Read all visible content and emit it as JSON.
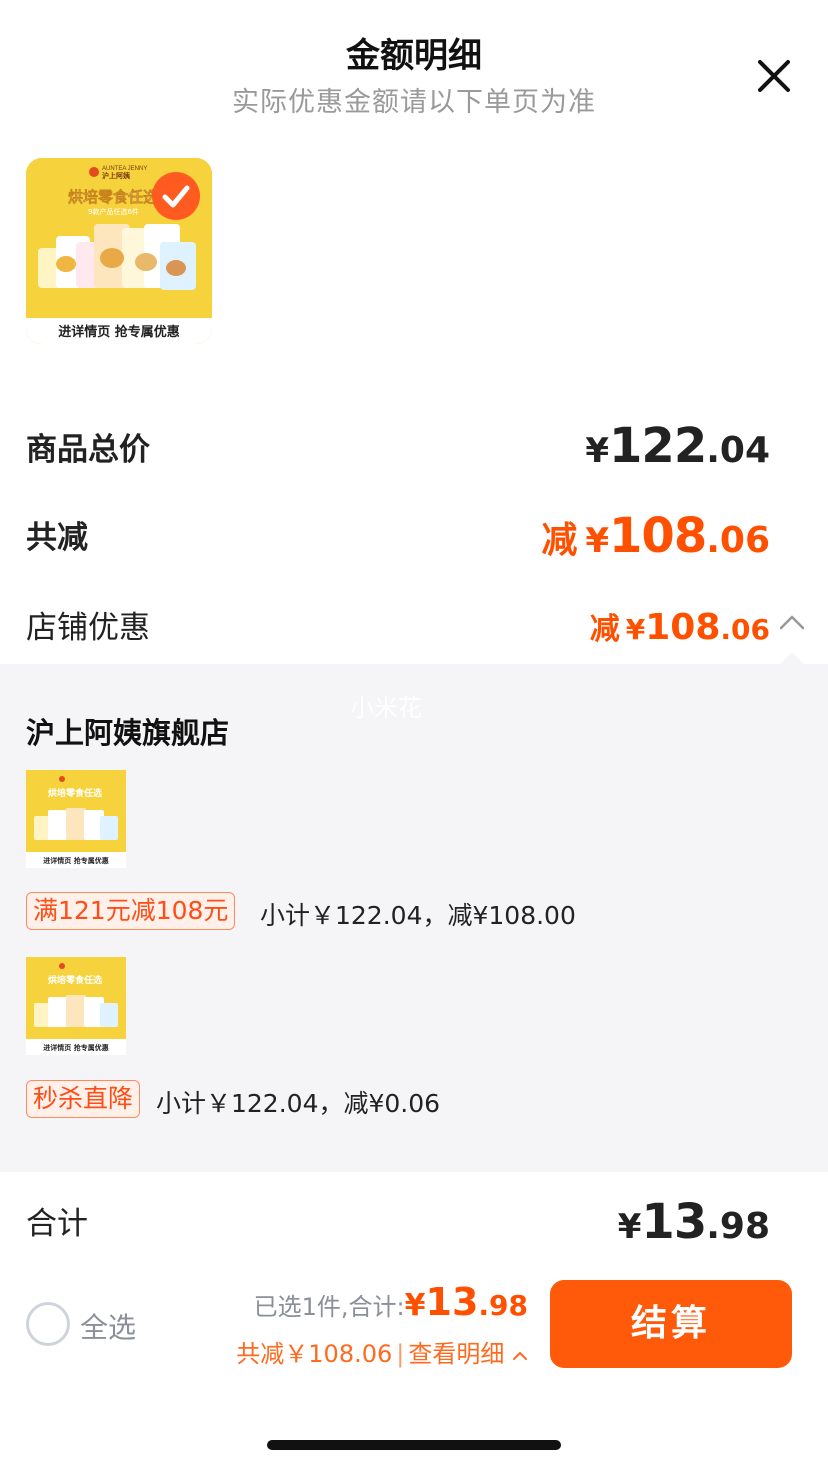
{
  "header": {
    "title": "金额明细",
    "subtitle": "实际优惠金额请以下单页为准",
    "close_icon": "close-icon"
  },
  "product": {
    "image_label": "进详情页 抢专属优惠",
    "image_heading": "烘培零食任选",
    "image_sub": "9款产品任选6件",
    "brand": "AUNTEA JENNY 沪上阿姨",
    "selected": true
  },
  "summary": {
    "goods_total_label": "商品总价",
    "goods_total": {
      "yen": "¥",
      "int": "122",
      "dec": ".04"
    },
    "total_discount_label": "共减",
    "total_discount": {
      "prefix": "减",
      "yen": "¥",
      "int": "108",
      "dec": ".06"
    },
    "store_discount_label": "店铺优惠",
    "store_discount": {
      "prefix": "减",
      "yen": "¥",
      "int": "108",
      "dec": ".06"
    }
  },
  "panel": {
    "watermark": "小米花",
    "store_name": "沪上阿姨旗舰店",
    "items": [
      {
        "tag": "满121元减108元",
        "text": "小计￥122.04，减¥108.00"
      },
      {
        "tag": "秒杀直降",
        "text": "小计￥122.04，减¥0.06"
      }
    ]
  },
  "total": {
    "label": "合计",
    "value": {
      "yen": "¥",
      "int": "13",
      "dec": ".98"
    }
  },
  "bottom_bar": {
    "select_all_label": "全选",
    "selected_text": "已选1件,",
    "sum_label": "合计:",
    "sum": {
      "yen": "¥",
      "int": "13",
      "dec": ".98"
    },
    "discount_text": "共减￥108.06",
    "separator": "|",
    "detail_link": "查看明细",
    "checkout_label": "结算"
  },
  "colors": {
    "accent": "#ff5000",
    "checkout": "#ff5a0a",
    "panel_bg": "#f5f5f7",
    "product_yellow": "#f6d23d"
  }
}
